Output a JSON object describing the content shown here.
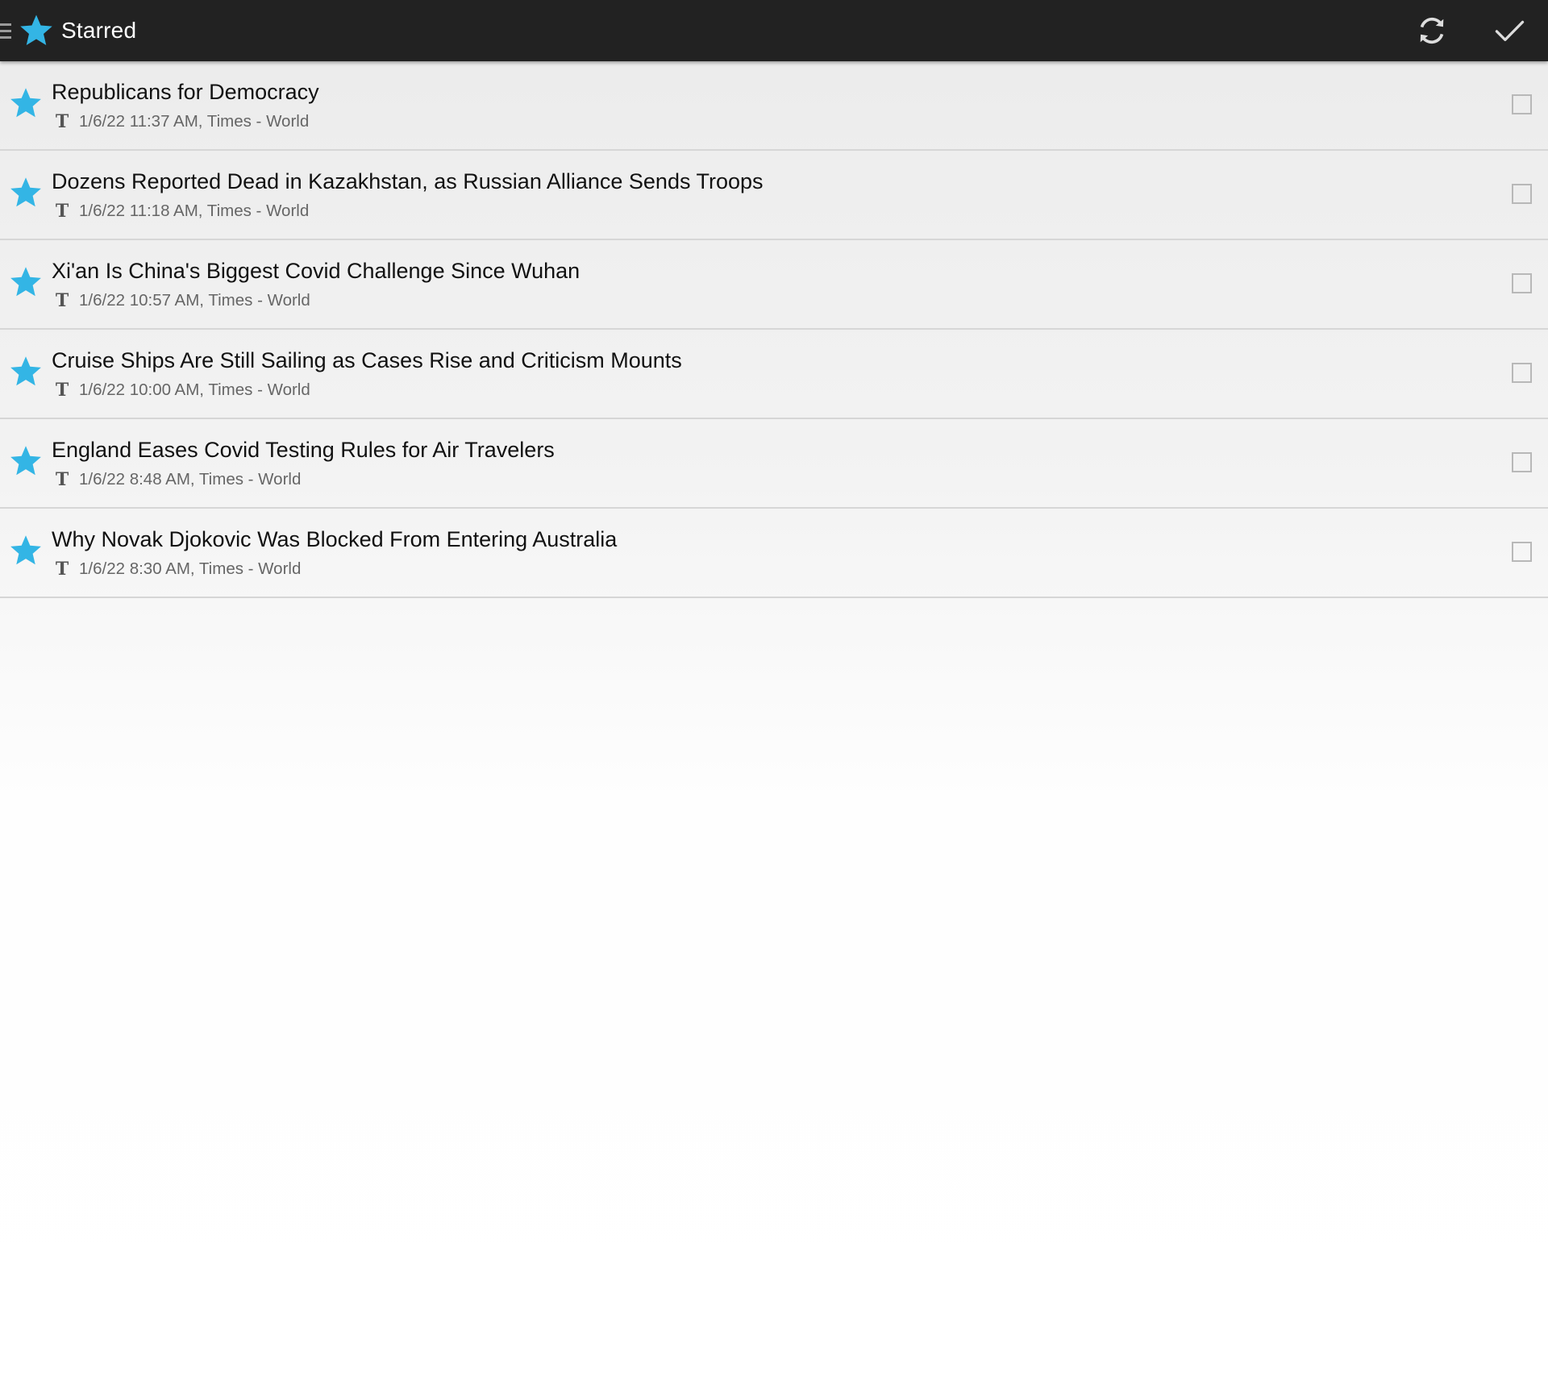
{
  "action_bar": {
    "title": "Starred",
    "title_icon": "star-icon",
    "actions": [
      {
        "name": "refresh-button",
        "icon": "refresh-icon"
      },
      {
        "name": "mark-read-button",
        "icon": "checkmark-icon"
      }
    ]
  },
  "colors": {
    "action_bar_bg": "#222222",
    "star": "#33b5e5",
    "title_text": "#111111",
    "meta_text": "#666666",
    "divider": "#d6d6d6"
  },
  "articles": [
    {
      "title": "Republicans for Democracy",
      "meta": "1/6/22 11:37 AM, Times - World",
      "feed_icon": "T",
      "starred": true,
      "checked": false
    },
    {
      "title": "Dozens Reported Dead in Kazakhstan, as Russian Alliance Sends Troops",
      "meta": "1/6/22 11:18 AM, Times - World",
      "feed_icon": "T",
      "starred": true,
      "checked": false
    },
    {
      "title": "Xi'an Is China's Biggest Covid Challenge Since Wuhan",
      "meta": "1/6/22 10:57 AM, Times - World",
      "feed_icon": "T",
      "starred": true,
      "checked": false
    },
    {
      "title": "Cruise Ships Are Still Sailing as Cases Rise and Criticism Mounts",
      "meta": "1/6/22 10:00 AM, Times - World",
      "feed_icon": "T",
      "starred": true,
      "checked": false
    },
    {
      "title": "England Eases Covid Testing Rules for Air Travelers",
      "meta": "1/6/22 8:48 AM, Times - World",
      "feed_icon": "T",
      "starred": true,
      "checked": false
    },
    {
      "title": "Why Novak Djokovic Was Blocked From Entering Australia",
      "meta": "1/6/22 8:30 AM, Times - World",
      "feed_icon": "T",
      "starred": true,
      "checked": false
    }
  ]
}
